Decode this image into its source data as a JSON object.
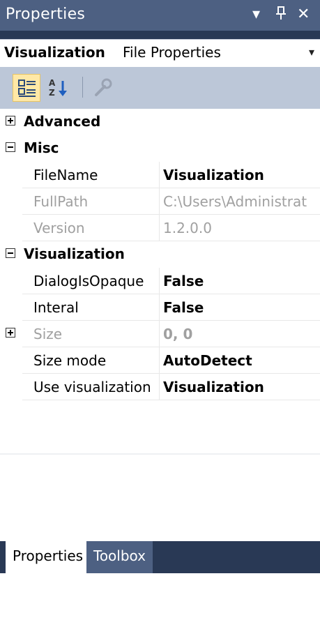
{
  "window": {
    "title": "Properties",
    "buttons": [
      {
        "name": "dropdown-icon",
        "glyph": "▾"
      },
      {
        "name": "pin-icon",
        "glyph": "ᛘ"
      },
      {
        "name": "close-icon",
        "glyph": "✕"
      }
    ]
  },
  "selector": {
    "object_name": "Visualization",
    "object_type": "File Properties",
    "arrow": "▾"
  },
  "toolbar": {
    "items": [
      {
        "name": "categorized-icon",
        "active": true
      },
      {
        "name": "alphabetical-icon",
        "active": false
      },
      {
        "name": "property-pages-icon",
        "active": false
      }
    ]
  },
  "grid": {
    "categories": [
      {
        "label": "Advanced",
        "expanded": false
      },
      {
        "label": "Misc",
        "expanded": true
      },
      {
        "label": "Visualization",
        "expanded": true
      }
    ],
    "misc_rows": [
      {
        "label": "FileName",
        "value": "Visualization",
        "bold": true,
        "readonly": false
      },
      {
        "label": "FullPath",
        "value": "C:\\Users\\Administrat",
        "bold": false,
        "readonly": true
      },
      {
        "label": "Version",
        "value": "1.2.0.0",
        "bold": false,
        "readonly": true
      }
    ],
    "vis_rows": [
      {
        "label": "DialogIsOpaque",
        "value": "False",
        "bold": true,
        "readonly": false,
        "expandable": false
      },
      {
        "label": "Interal",
        "value": "False",
        "bold": true,
        "readonly": false,
        "expandable": false
      },
      {
        "label": "Size",
        "value": "0, 0",
        "bold": true,
        "readonly": true,
        "expandable": true
      },
      {
        "label": "Size mode",
        "value": "AutoDetect",
        "bold": true,
        "readonly": false,
        "expandable": false
      },
      {
        "label": "Use visualization",
        "value": "Visualization",
        "bold": true,
        "readonly": false,
        "expandable": false
      }
    ]
  },
  "tabs": [
    {
      "label": "Properties",
      "active": true
    },
    {
      "label": "Toolbox",
      "active": false
    }
  ],
  "colors": {
    "title_bar": "#4d6082",
    "background": "#293955",
    "toolbar": "#bcc7d8",
    "readonly_text": "#a0a0a0"
  }
}
